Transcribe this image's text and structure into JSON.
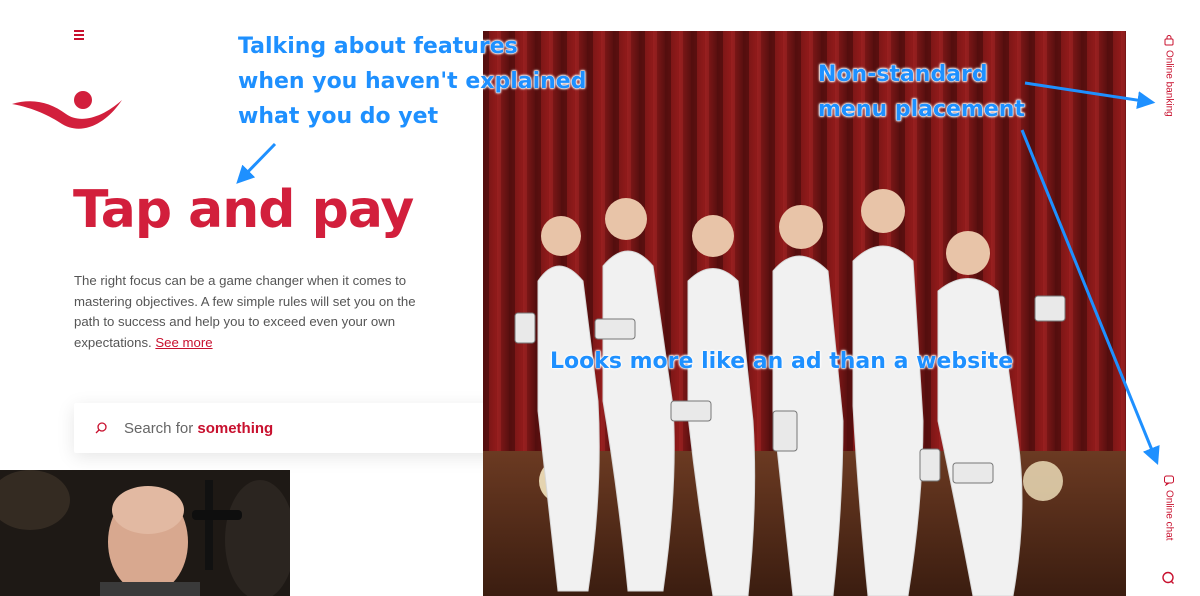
{
  "header": {
    "menu_icon": "hamburger-icon",
    "logo_icon": "swoosh-person-logo"
  },
  "hero": {
    "title": "Tap and pay",
    "body": "The right focus can be a game changer when it comes to mastering objectives. A few simple rules will set you on the path to success and help you to exceed even your own expectations.",
    "see_more": "See more"
  },
  "search": {
    "prefix": "Search for ",
    "highlight": "something",
    "icon": "search-icon",
    "dropdown_icon": "chevron-down-icon"
  },
  "side_nav": {
    "online_banking": "Online banking",
    "online_chat": "Online chat",
    "help_icon": "chat-bubble-icon"
  },
  "annotations": {
    "features_line1": "Talking about features",
    "features_line2": "when you haven't explained",
    "features_line3": "what you do yet",
    "menu_line1": "Non-standard",
    "menu_line2": "menu placement",
    "ad": "Looks more like an ad than a website"
  },
  "colors": {
    "brand_red": "#d21f3c",
    "annotation_blue": "#1e90ff"
  }
}
